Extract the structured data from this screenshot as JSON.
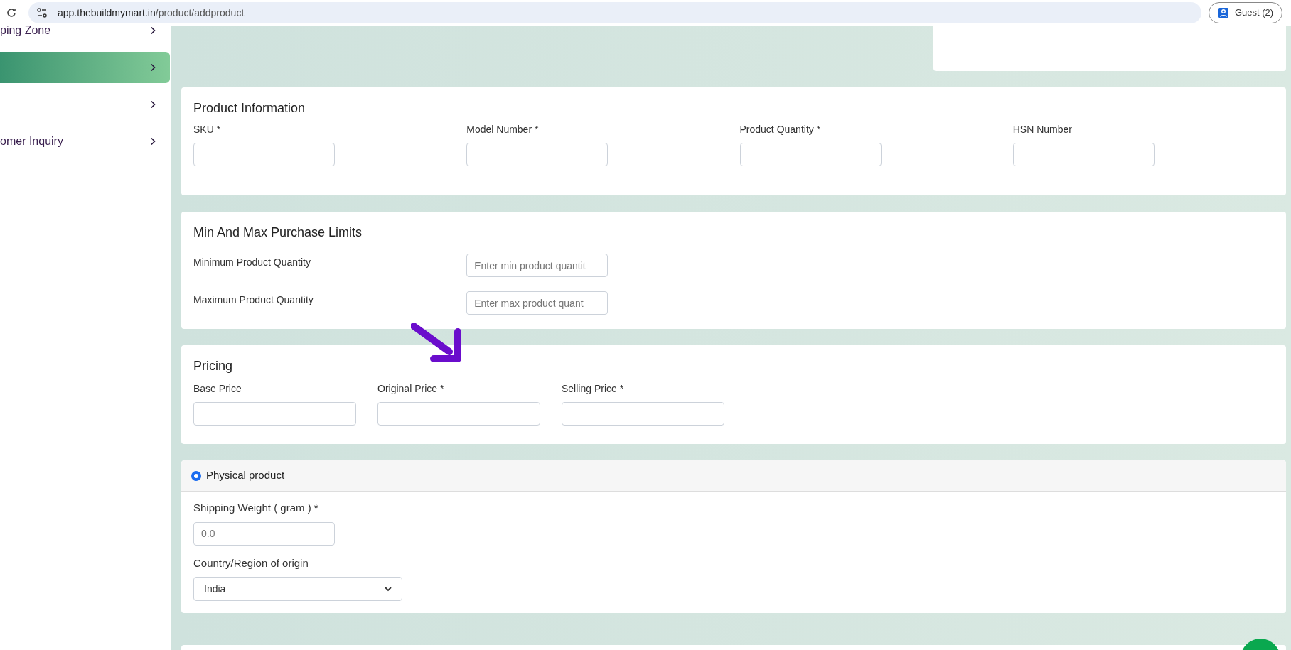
{
  "browser": {
    "url_host": "app.thebuildmymart.in",
    "url_path": "/product/addproduct",
    "profile": "Guest (2)"
  },
  "sidebar": {
    "items": [
      {
        "label": "ping Zone",
        "selected": false
      },
      {
        "selected": true
      },
      {
        "selected": false
      },
      {
        "label": "omer Inquiry",
        "selected": false
      }
    ]
  },
  "sections": [
    {
      "kind": "grid",
      "title": "Product Information",
      "fields": [
        {
          "label": "SKU *"
        },
        {
          "label": "Model Number *"
        },
        {
          "label": "Product Quantity *"
        },
        {
          "label": "HSN Number"
        }
      ]
    },
    {
      "kind": "rows",
      "title": "Min And Max Purchase Limits",
      "fields": [
        {
          "label": "Minimum Product Quantity",
          "placeholder": "Enter min product quantit"
        },
        {
          "label": "Maximum Product Quantity",
          "placeholder": "Enter max product quant"
        }
      ]
    },
    {
      "kind": "pricing",
      "title": "Pricing",
      "fields": [
        {
          "label": "Base Price"
        },
        {
          "label": "Original Price *"
        },
        {
          "label": "Selling Price *"
        }
      ]
    },
    {
      "kind": "physical",
      "radio": {
        "label": "Physical product",
        "selected": true
      },
      "fields": [
        {
          "label": "Shipping Weight ( gram ) *",
          "placeholder": "0.0"
        },
        {
          "label": "Country/Region of origin",
          "value": "India"
        }
      ]
    }
  ]
}
